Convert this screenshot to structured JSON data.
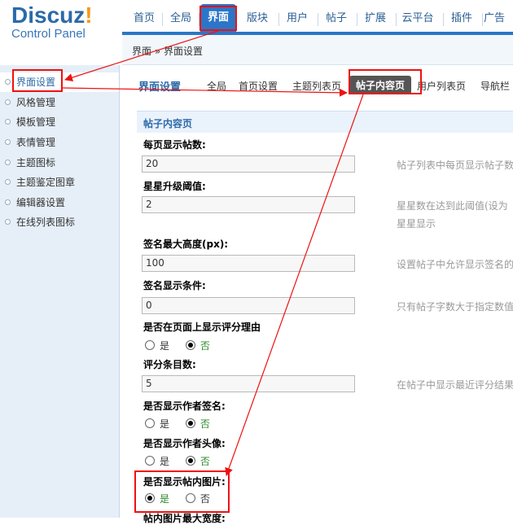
{
  "logo": {
    "brand": "Discuz",
    "bang": "!",
    "sub": "Control Panel"
  },
  "topnav": [
    "首页",
    "全局",
    "界面",
    "版块",
    "用户",
    "帖子",
    "扩展",
    "云平台",
    "插件",
    "广告"
  ],
  "breadcrumb": "界面 » 界面设置",
  "sidebar": [
    "界面设置",
    "风格管理",
    "模板管理",
    "表情管理",
    "主题图标",
    "主题鉴定图章",
    "编辑器设置",
    "在线列表图标"
  ],
  "subnav": {
    "title": "界面设置",
    "tabs": [
      "全局",
      "首页设置",
      "主题列表页",
      "帖子内容页",
      "用户列表页",
      "导航栏"
    ]
  },
  "section": {
    "title": "帖子内容页"
  },
  "fields": {
    "f1": {
      "label": "每页显示帖数:",
      "value": "20",
      "hint": "帖子列表中每页显示帖子数"
    },
    "f2": {
      "label": "星星升级阈值:",
      "value": "2",
      "hint1": "星星数在达到此阈值(设为",
      "hint2": "星星显示"
    },
    "f3": {
      "label": "签名最大高度(px):",
      "value": "100",
      "hint": "设置帖子中允许显示签名的"
    },
    "f4": {
      "label": "签名显示条件:",
      "value": "0",
      "hint": "只有帖子字数大于指定数值"
    },
    "f5": {
      "label": "是否在页面上显示评分理由",
      "yes": "是",
      "no": "否"
    },
    "f6": {
      "label": "评分条目数:",
      "value": "5",
      "hint": "在帖子中显示最近评分结果"
    },
    "f7": {
      "label": "是否显示作者签名:",
      "yes": "是",
      "no": "否"
    },
    "f8": {
      "label": "是否显示作者头像:",
      "yes": "是",
      "no": "否"
    },
    "f9": {
      "label": "是否显示帖内图片:",
      "yes": "是",
      "no": "否"
    },
    "f10": {
      "label": "帖内图片最大宽度:"
    }
  },
  "radio_state": {
    "f5": "no",
    "f7": "no",
    "f8": "no",
    "f9": "yes"
  },
  "colors": {
    "accent": "#2b76c8",
    "annotation": "#e11111"
  }
}
